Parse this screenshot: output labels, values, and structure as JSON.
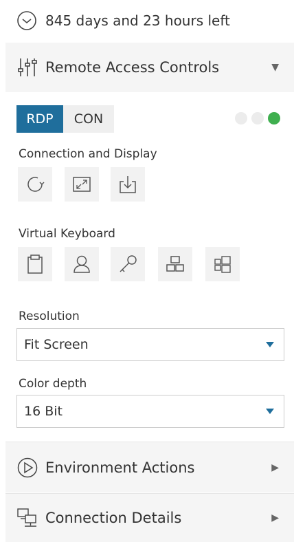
{
  "countdown": {
    "text": "845 days and 23 hours left",
    "icon": "clock-icon"
  },
  "remote_access": {
    "title": "Remote Access Controls",
    "icon": "sliders-icon",
    "tabs": [
      {
        "label": "RDP",
        "active": true
      },
      {
        "label": "CON",
        "active": false
      }
    ],
    "status_dots": [
      "#ececec",
      "#ececec",
      "#3faf4f"
    ],
    "connection_display": {
      "label": "Connection and Display",
      "buttons": [
        "reconnect-icon",
        "fullscreen-icon",
        "download-icon"
      ]
    },
    "virtual_keyboard": {
      "label": "Virtual Keyboard",
      "buttons": [
        "clipboard-icon",
        "user-icon",
        "key-icon",
        "ctrl-alt-del-icon",
        "windows-key-icon"
      ]
    },
    "resolution": {
      "label": "Resolution",
      "value": "Fit Screen"
    },
    "color_depth": {
      "label": "Color depth",
      "value": "16 Bit"
    }
  },
  "environment_actions": {
    "title": "Environment Actions",
    "icon": "play-circle-icon"
  },
  "connection_details": {
    "title": "Connection Details",
    "icon": "network-icon"
  },
  "colors": {
    "accent": "#1f6e9c",
    "header_bg": "#f5f5f5",
    "button_bg": "#f2f2f2",
    "status_green": "#3faf4f"
  }
}
